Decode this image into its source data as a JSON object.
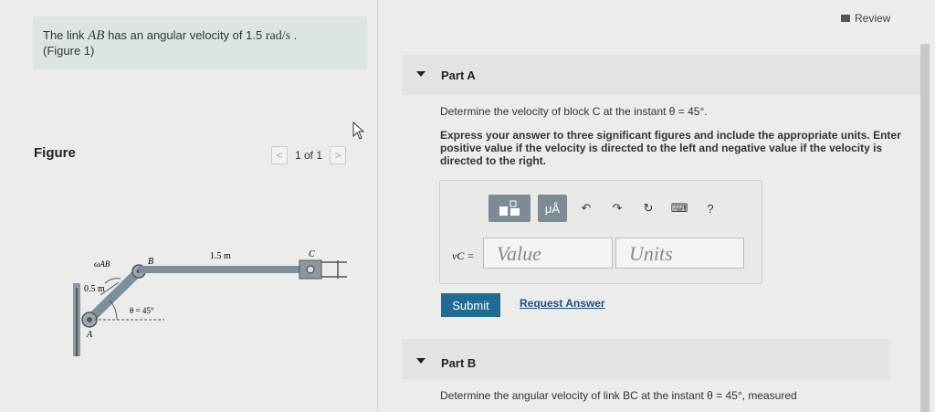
{
  "problem": {
    "line1_prefix": "The link ",
    "link_name": "AB",
    "line1_mid": " has an angular velocity of 1.5 ",
    "unit": "rad/s",
    "line1_suffix": " .",
    "line2": "(Figure 1)"
  },
  "review": {
    "label": "Review"
  },
  "figure": {
    "label": "Figure",
    "pager": {
      "prev": "<",
      "text": "1 of 1",
      "next": ">"
    },
    "labels": {
      "omega": "ωAB",
      "b": "B",
      "c": "C",
      "a": "A",
      "len_bc": "1.5 m",
      "len_ab": "0.5 m",
      "theta": "θ = 45°"
    }
  },
  "partA": {
    "title": "Part A",
    "question": "Determine the velocity of block C at the instant θ = 45°.",
    "instructions": "Express your answer to three significant figures and include the appropriate units. Enter positive value if the velocity is directed to the left and negative value if the velocity is directed to the right.",
    "toolbar": {
      "matrix_icon": "template-icon",
      "units_label": "μÅ",
      "undo": "↶",
      "redo": "↷",
      "reset": "↻",
      "keyboard": "⌨",
      "help": "?"
    },
    "var_label": "vC =",
    "value_placeholder": "Value",
    "units_placeholder": "Units",
    "submit": "Submit",
    "request": "Request Answer"
  },
  "partB": {
    "title": "Part B",
    "question": "Determine the angular velocity of link BC at the instant θ = 45°, measured"
  }
}
